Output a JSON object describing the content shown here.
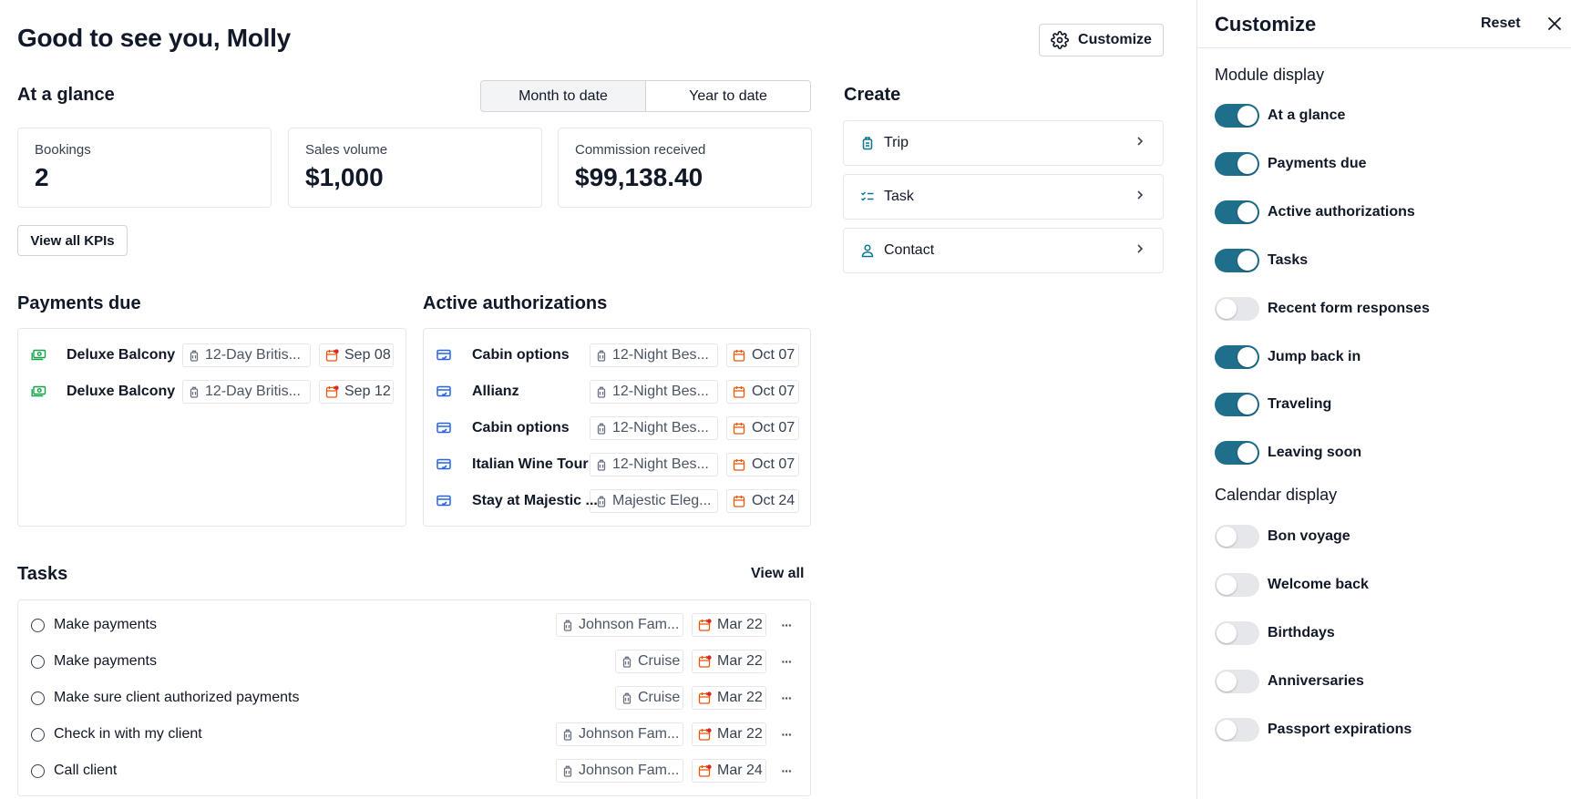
{
  "greeting": "Good to see you, Molly",
  "customize_button": "Customize",
  "at_a_glance": {
    "title": "At a glance",
    "segments": [
      {
        "label": "Month to date",
        "active": true
      },
      {
        "label": "Year to date",
        "active": false
      }
    ],
    "kpis": [
      {
        "label": "Bookings",
        "value": "2"
      },
      {
        "label": "Sales volume",
        "value": "$1,000"
      },
      {
        "label": "Commission received",
        "value": "$99,138.40"
      }
    ],
    "view_all_kpis": "View all KPIs"
  },
  "create": {
    "title": "Create",
    "items": [
      {
        "label": "Trip",
        "icon": "luggage-icon"
      },
      {
        "label": "Task",
        "icon": "checklist-icon"
      },
      {
        "label": "Contact",
        "icon": "person-icon"
      }
    ]
  },
  "payments_due": {
    "title": "Payments due",
    "rows": [
      {
        "title": "Deluxe Balcony",
        "trip": "12-Day Britis...",
        "date": "Sep 08"
      },
      {
        "title": "Deluxe Balcony",
        "trip": "12-Day Britis...",
        "date": "Sep 12"
      }
    ]
  },
  "active_authorizations": {
    "title": "Active authorizations",
    "rows": [
      {
        "title": "Cabin options",
        "trip": "12-Night Bes...",
        "date": "Oct 07"
      },
      {
        "title": "Allianz",
        "trip": "12-Night Bes...",
        "date": "Oct 07"
      },
      {
        "title": "Cabin options",
        "trip": "12-Night Bes...",
        "date": "Oct 07"
      },
      {
        "title": "Italian Wine Tour",
        "trip": "12-Night Bes...",
        "date": "Oct 07"
      },
      {
        "title": "Stay at Majestic ...",
        "trip": "Majestic Eleg...",
        "date": "Oct 24"
      }
    ]
  },
  "tasks": {
    "title": "Tasks",
    "view_all": "View all",
    "rows": [
      {
        "title": "Make payments",
        "trip": "Johnson Fam...",
        "date": "Mar 22"
      },
      {
        "title": "Make payments",
        "trip": "Cruise",
        "date": "Mar 22"
      },
      {
        "title": "Make sure client authorized payments",
        "trip": "Cruise",
        "date": "Mar 22"
      },
      {
        "title": "Check in with my client",
        "trip": "Johnson Fam...",
        "date": "Mar 22"
      },
      {
        "title": "Call client",
        "trip": "Johnson Fam...",
        "date": "Mar 24"
      }
    ],
    "more_label": "···"
  },
  "panel": {
    "title": "Customize",
    "reset": "Reset",
    "module_display_title": "Module display",
    "modules": [
      {
        "label": "At a glance",
        "on": true
      },
      {
        "label": "Payments due",
        "on": true
      },
      {
        "label": "Active authorizations",
        "on": true
      },
      {
        "label": "Tasks",
        "on": true
      },
      {
        "label": "Recent form responses",
        "on": false
      },
      {
        "label": "Jump back in",
        "on": true
      },
      {
        "label": "Traveling",
        "on": true
      },
      {
        "label": "Leaving soon",
        "on": true
      }
    ],
    "calendar_display_title": "Calendar display",
    "calendar": [
      {
        "label": "Bon voyage",
        "on": false
      },
      {
        "label": "Welcome back",
        "on": false
      },
      {
        "label": "Birthdays",
        "on": false
      },
      {
        "label": "Anniversaries",
        "on": false
      },
      {
        "label": "Passport expirations",
        "on": false
      }
    ]
  },
  "colors": {
    "toggle_on": "#1f6e8c",
    "payment_icon": "#16a34a",
    "auth_icon": "#2563eb",
    "date_icon": "#ea580c",
    "overdue_dot": "#dc2626",
    "create_icon": "#0e7490"
  }
}
